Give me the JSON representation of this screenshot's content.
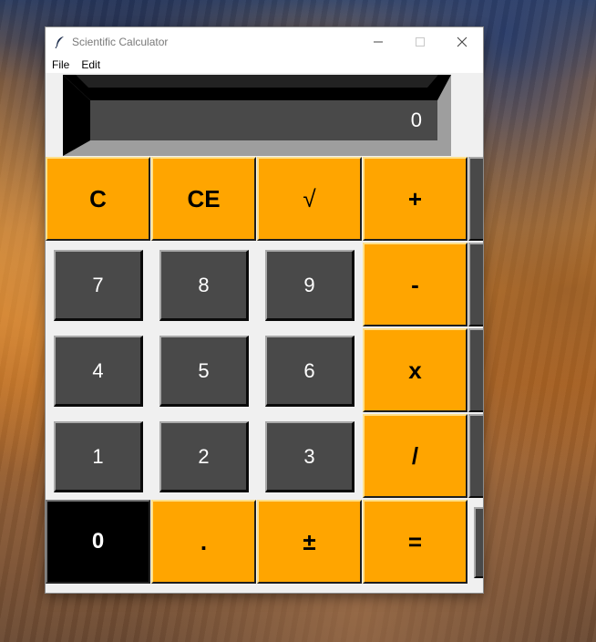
{
  "window": {
    "title": "Scientific Calculator",
    "icon": "feather-icon"
  },
  "menu": {
    "items": [
      {
        "label": "File"
      },
      {
        "label": "Edit"
      }
    ]
  },
  "display": {
    "value": "0"
  },
  "keypad": {
    "row1": [
      "C",
      "CE",
      "√",
      "+"
    ],
    "row2": [
      "7",
      "8",
      "9",
      "-"
    ],
    "row3": [
      "4",
      "5",
      "6",
      "x"
    ],
    "row4": [
      "1",
      "2",
      "3",
      "/"
    ],
    "row5": [
      "0",
      ".",
      "±",
      "="
    ]
  },
  "colors": {
    "operator_key": "#ffa500",
    "number_key": "#494949",
    "zero_key": "#000000",
    "display_bg": "#494949",
    "window_bg": "#f0f0f0"
  }
}
